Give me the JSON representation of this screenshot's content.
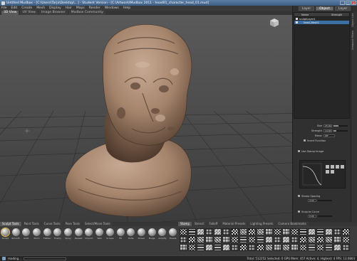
{
  "window": {
    "title": "Untitled Mudbox - [C:\\Users\\Tarja\\Desktop\\...] - Student Version - [C:\\Artwork\\Mudbox 2011 - head01_character_head_01.mud]",
    "controls": [
      "_",
      "□",
      "✕"
    ]
  },
  "menu": [
    "File",
    "Edit",
    "Create",
    "Mesh",
    "Display",
    "Hair",
    "Maps",
    "Render",
    "Windows",
    "Help"
  ],
  "viewport_tabs": [
    {
      "label": "3D View",
      "active": true
    },
    {
      "label": "UV View",
      "active": false
    },
    {
      "label": "Image Browser",
      "active": false
    },
    {
      "label": "Mudbox Community",
      "active": false
    }
  ],
  "dock_tabs": [
    {
      "label": "Layer",
      "active": false
    },
    {
      "label": "Object",
      "active": true
    },
    {
      "label": "Layer",
      "active": false
    }
  ],
  "side_strip": [
    "Object List",
    "Viewport Filters"
  ],
  "outliner": {
    "header_name": "Name",
    "header_strength": "Strength",
    "rows": [
      {
        "label": "sculptLayer1",
        "selected": false
      },
      {
        "label": "head_Mesh1",
        "selected": true
      }
    ]
  },
  "properties": {
    "size_label": "Size",
    "size_value": "25.00",
    "size_level": 0.35,
    "strength_label": "Strength",
    "strength_value": "14.00",
    "strength_level": 0.2,
    "mirror_label": "Mirror",
    "mirror_value": "Off",
    "invert_label": "Invert Function",
    "use_stamp_label": "Use Stamp Image",
    "stamp_spacing_label": "Stamp Spacing",
    "stamp_spacing_value": "4.00",
    "snap_label": "Snap to Curve",
    "snap_value": "0.00"
  },
  "tool_tray_tabs": [
    {
      "label": "Sculpt Tools",
      "active": true
    },
    {
      "label": "Paint Tools",
      "active": false
    },
    {
      "label": "Curve Tools",
      "active": false
    },
    {
      "label": "Pose Tools",
      "active": false
    },
    {
      "label": "Select/Move Tools",
      "active": false
    }
  ],
  "tools": [
    {
      "label": "Sculpt",
      "selected": true
    },
    {
      "label": "Smooth",
      "selected": false
    },
    {
      "label": "Grab",
      "selected": false
    },
    {
      "label": "Pinch",
      "selected": false
    },
    {
      "label": "Flatten",
      "selected": false
    },
    {
      "label": "Foamy",
      "selected": false
    },
    {
      "label": "Spray",
      "selected": false
    },
    {
      "label": "Repeat",
      "selected": false
    },
    {
      "label": "Imprint",
      "selected": false
    },
    {
      "label": "Wax",
      "selected": false
    },
    {
      "label": "Scrape",
      "selected": false
    },
    {
      "label": "Fill",
      "selected": false
    },
    {
      "label": "Knife",
      "selected": false
    },
    {
      "label": "Smear",
      "selected": false
    },
    {
      "label": "Bulge",
      "selected": false
    },
    {
      "label": "Amplify",
      "selected": false
    },
    {
      "label": "Freeze",
      "selected": false
    }
  ],
  "stamp_tray_tabs": [
    {
      "label": "Stamp",
      "active": true
    },
    {
      "label": "Stencil",
      "active": false
    },
    {
      "label": "Falloff",
      "active": false
    },
    {
      "label": "Material Presets",
      "active": false
    },
    {
      "label": "Lighting Presets",
      "active": false
    },
    {
      "label": "Camera Bookmarks",
      "active": false
    }
  ],
  "status": {
    "left_text": "reading...",
    "right_text": "Total: 512252  Selected: 0  GPU Mem: 457  Active: 4, Highest: 4  FPS: 13.0803"
  },
  "colors": {
    "selection": "#3b6fa3",
    "viewport_top": "#5a5a5a",
    "viewport_bottom": "#3c3c3c",
    "sculpt_clay": "#a5846c"
  }
}
